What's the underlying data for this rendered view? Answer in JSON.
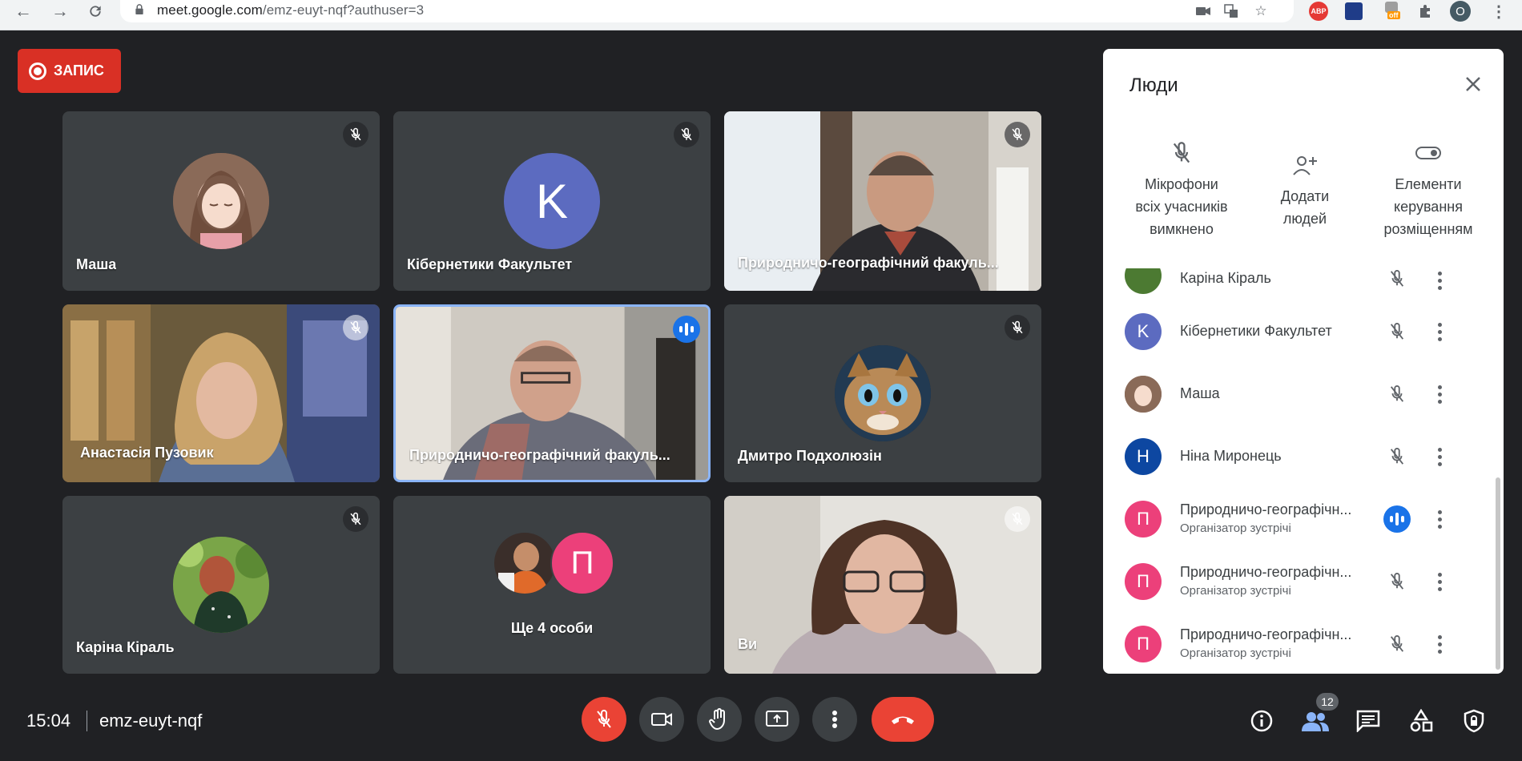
{
  "browser": {
    "url_host": "meet.google.com",
    "url_rest": "/emz-euyt-nqf?authuser=3",
    "profile_initial": "O",
    "abp_label": "ABP",
    "off_label": "off"
  },
  "recording": {
    "label": "ЗАПИС"
  },
  "tiles": [
    {
      "name": "Маша"
    },
    {
      "name": "Кібернетики Факультет",
      "avatar_letter": "K"
    },
    {
      "name": "Природничо-географічний факуль..."
    },
    {
      "name": "Анастасія Пузовик"
    },
    {
      "name": "Природничо-географічний факуль..."
    },
    {
      "name": "Дмитро Подхолюзін"
    },
    {
      "name": "Каріна Кіраль"
    },
    {
      "name": "Ще 4 особи",
      "avatar_letter": "П"
    },
    {
      "name": "Ви"
    }
  ],
  "people_panel": {
    "title": "Люди",
    "actions": [
      {
        "label_lines": [
          "Мікрофони",
          "всіх учасників",
          "вимкнено"
        ]
      },
      {
        "label_lines": [
          "Додати",
          "людей"
        ]
      },
      {
        "label_lines": [
          "Елементи",
          "керування",
          "розміщенням"
        ]
      }
    ],
    "participants": [
      {
        "name": "Каріна Кіраль",
        "subtitle": ""
      },
      {
        "name": "Кібернетики Факультет",
        "initial": "K",
        "subtitle": ""
      },
      {
        "name": "Маша",
        "subtitle": ""
      },
      {
        "name": "Ніна Миронець",
        "initial": "Н",
        "subtitle": ""
      },
      {
        "name": "Природничо-географічн...",
        "initial": "П",
        "subtitle": "Організатор зустрічі"
      },
      {
        "name": "Природничо-географічн...",
        "initial": "П",
        "subtitle": "Організатор зустрічі"
      },
      {
        "name": "Природничо-географічн...",
        "initial": "П",
        "subtitle": "Організатор зустрічі"
      }
    ]
  },
  "bottom_bar": {
    "time": "15:04",
    "meeting_code": "emz-euyt-nqf",
    "people_count": "12"
  },
  "colors": {
    "background": "#202124",
    "tile": "#3c4043",
    "record_red": "#d93025",
    "end_call_red": "#ea4335",
    "speaking_blue": "#1a73e8",
    "avatar_k": "#5c6bc0",
    "avatar_p": "#ec407a",
    "avatar_n": "#0d47a1"
  }
}
